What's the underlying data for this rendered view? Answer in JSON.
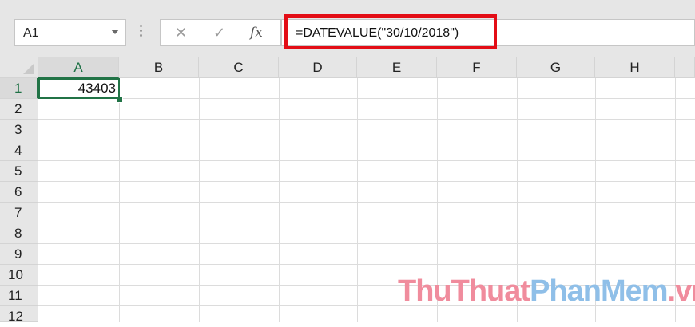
{
  "name_box": {
    "value": "A1"
  },
  "formula_bar": {
    "cancel_icon": "x-icon",
    "enter_icon": "check-icon",
    "fx_label": "fx",
    "formula": "=DATEVALUE(\"30/10/2018\")"
  },
  "sheet": {
    "columns": [
      "A",
      "B",
      "C",
      "D",
      "E",
      "F",
      "G",
      "H"
    ],
    "rows": [
      "1",
      "2",
      "3",
      "4",
      "5",
      "6",
      "7",
      "8",
      "9",
      "10",
      "11",
      "12"
    ],
    "active_cell": "A1",
    "cells": {
      "A1": "43403"
    }
  },
  "watermark": {
    "part1": "ThuThuat",
    "part2": "PhanMem",
    "part3": ".vn"
  },
  "colors": {
    "highlight": "#e30d16",
    "excel_green": "#217346"
  }
}
